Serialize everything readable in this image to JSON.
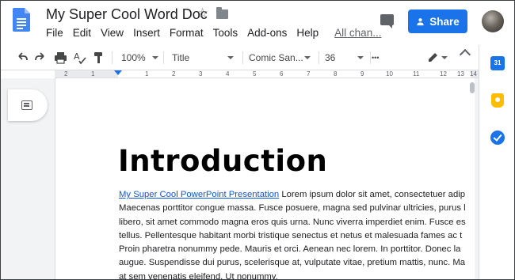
{
  "header": {
    "doc_title": "My Super Cool Word Doc",
    "menu": [
      "File",
      "Edit",
      "View",
      "Insert",
      "Format",
      "Tools",
      "Add-ons",
      "Help"
    ],
    "last_edit_link": "All chan...",
    "share_label": "Share",
    "accent": "#1a73e8"
  },
  "toolbar": {
    "zoom": "100%",
    "style": "Title",
    "font": "Comic San...",
    "font_size": "36",
    "more": "•••"
  },
  "ruler": {
    "numbers": [
      "2",
      "1",
      "1",
      "2",
      "3",
      "4",
      "5",
      "6",
      "7",
      "8",
      "9",
      "10",
      "11",
      "12",
      "13",
      "14"
    ]
  },
  "document": {
    "heading": "Introduction",
    "link_text": "My Super Cool PowerPoint Presentation",
    "lines": [
      " Lorem ipsum dolor sit amet, consectetuer adip",
      "Maecenas porttitor congue massa. Fusce posuere, magna sed pulvinar ultricies, purus l",
      "libero, sit amet commodo magna eros quis urna. Nunc viverra imperdiet enim. Fusce es",
      "tellus. Pellentesque habitant morbi tristique senectus et netus et malesuada fames ac t",
      "Proin pharetra nonummy pede. Mauris et orci. Aenean nec lorem. In porttitor. Donec la",
      "augue. Suspendisse dui purus, scelerisque at, vulputate vitae, pretium mattis, nunc. Ma",
      "at sem venenatis eleifend. Ut nonummy."
    ]
  },
  "side_panel": {
    "calendar_label": "31",
    "icons": [
      "calendar-icon",
      "keep-icon",
      "tasks-icon"
    ]
  }
}
